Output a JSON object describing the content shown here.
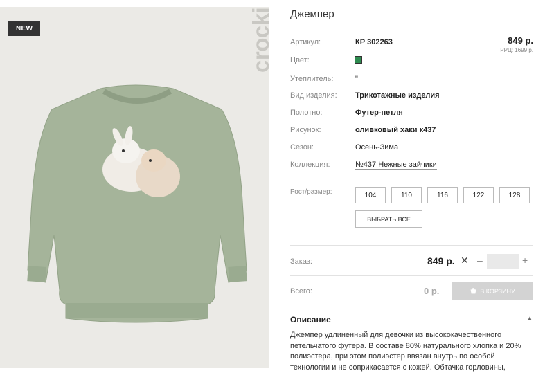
{
  "product": {
    "badge": "NEW",
    "brand": "crockid",
    "title": "Джемпер",
    "price": "849 р.",
    "rrc": "РРЦ: 1699 р."
  },
  "attributes": [
    {
      "label": "Артикул:",
      "value": "КР 302263"
    },
    {
      "label": "Цвет:",
      "value": ""
    },
    {
      "label": "Утеплитель:",
      "value": "\""
    },
    {
      "label": "Вид изделия:",
      "value": "Трикотажные изделия"
    },
    {
      "label": "Полотно:",
      "value": "Футер-петля"
    },
    {
      "label": "Рисунок:",
      "value": "оливковый хаки к437"
    },
    {
      "label": "Сезон:",
      "value": "Осень-Зима"
    },
    {
      "label": "Коллекция:",
      "value": "№437 Нежные зайчики"
    }
  ],
  "color_swatch": "#2e8b4f",
  "sizes": {
    "label": "Рост/размер:",
    "options": [
      "104",
      "110",
      "116",
      "122",
      "128"
    ],
    "select_all": "ВЫБРАТЬ ВСЕ"
  },
  "order": {
    "label": "Заказ:",
    "price": "849 р.",
    "times": "✕",
    "minus": "–",
    "plus": "+",
    "quantity": ""
  },
  "total": {
    "label": "Всего:",
    "value": "0 р.",
    "cart_button": "В КОРЗИНУ"
  },
  "description": {
    "title": "Описание",
    "text": "Джемпер удлиненный для девочки из высококачественного петельчатого футера. В составе 80% натурального хлопка и 20% полиэстера, при этом полиэстер ввязан внутрь по особой технологии и не соприкасается с кожей. Обтачка горловины,"
  }
}
